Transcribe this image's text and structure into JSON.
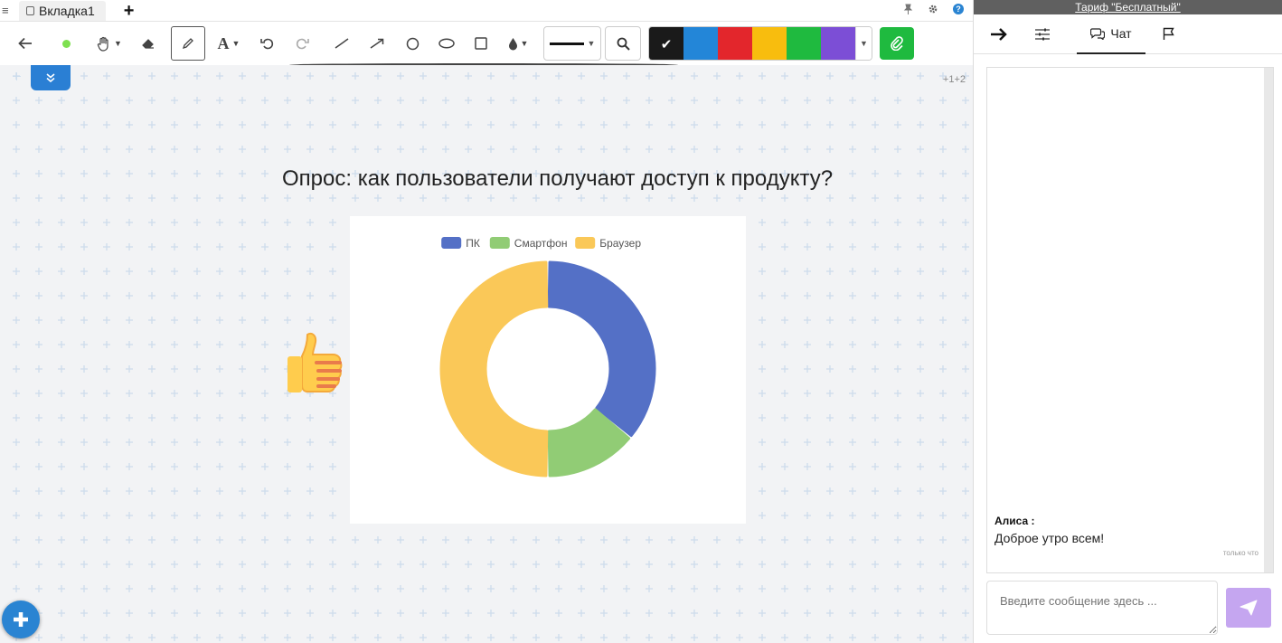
{
  "tabbar": {
    "tabs": [
      {
        "label": "Вкладка1"
      }
    ],
    "add_tab_icon": "plus-icon",
    "right_icons": [
      "pin-icon",
      "gear-icon",
      "help-icon"
    ],
    "help_glyph": "?"
  },
  "toolbar": {
    "tools": [
      "back-arrow-icon",
      "color-dot-icon",
      "hand-icon",
      "eraser-icon",
      "pencil-icon",
      "text-icon",
      "undo-icon",
      "redo-icon",
      "line-icon",
      "arrow-icon",
      "circle-icon",
      "ellipse-icon",
      "rectangle-icon",
      "fill-icon"
    ],
    "text_tool_glyph": "A",
    "active_tool": "pencil",
    "colors": [
      "#1a1a1a",
      "#2386d8",
      "#e3262c",
      "#f8bd0e",
      "#1fba3f",
      "#7c4ed6"
    ],
    "selected_color": "#1a1a1a"
  },
  "board": {
    "counter": "+1+2",
    "title": "Опрос: как пользователи получают доступ к продукту?"
  },
  "chart_data": {
    "type": "pie",
    "variant": "doughnut",
    "title": "",
    "legend_position": "top",
    "series": [
      {
        "name": "ПК",
        "value": 36,
        "color": "#5470c6"
      },
      {
        "name": "Смартфон",
        "value": 14,
        "color": "#91cc75"
      },
      {
        "name": "Браузер",
        "value": 50,
        "color": "#fac858"
      }
    ]
  },
  "panel": {
    "plan_link": "Тариф \"Бесплатный\"",
    "tabs": {
      "chat_label": "Чат"
    },
    "messages": [
      {
        "author": "Алиса :",
        "text": "Доброе утро всем!",
        "time": "только что"
      }
    ],
    "input_placeholder": "Введите сообщение здесь ..."
  }
}
